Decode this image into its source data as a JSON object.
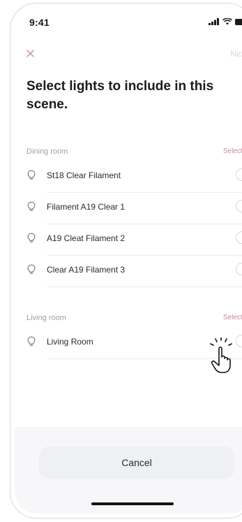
{
  "status": {
    "time": "9:41",
    "signal_icon": "signal-bars-icon",
    "wifi_icon": "wifi-icon",
    "battery_icon": "battery-icon"
  },
  "nav": {
    "close_icon": "close-icon",
    "next_label": "Next"
  },
  "title": "Select lights to include in this scene.",
  "sections": [
    {
      "label": "Dining room",
      "select_all": "Select All",
      "items": [
        {
          "label": "St18 Clear Filament",
          "selected": false
        },
        {
          "label": "Filament A19 Clear 1",
          "selected": false
        },
        {
          "label": "A19 Cleat Filament 2",
          "selected": false
        },
        {
          "label": "Clear A19 Filament 3",
          "selected": false
        }
      ]
    },
    {
      "label": "Living room",
      "select_all": "Select All",
      "items": [
        {
          "label": "Living Room",
          "selected": false
        }
      ]
    }
  ],
  "cancel_label": "Cancel",
  "colors": {
    "accent": "#c98a97",
    "text": "#1b1b1f",
    "muted": "#9ea0a8",
    "button_bg": "#eef0f3"
  }
}
